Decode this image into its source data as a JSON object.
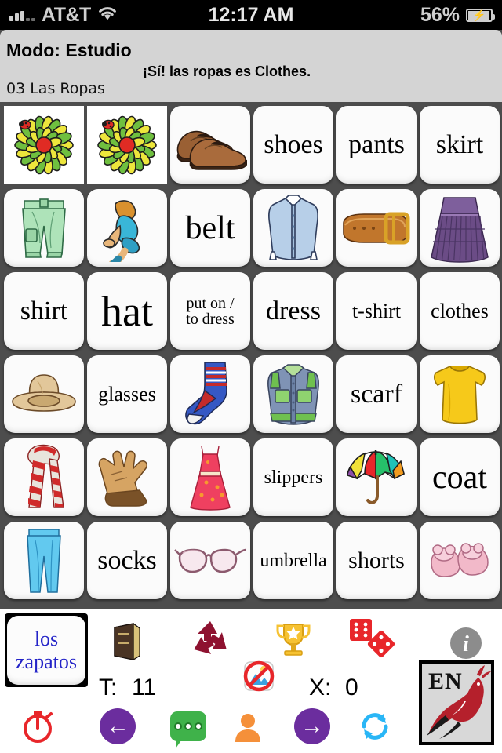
{
  "status_bar": {
    "carrier": "AT&T",
    "time": "12:17 AM",
    "battery_percent": "56%",
    "signal_icon": "signal-bars-icon",
    "wifi_icon": "wifi-icon",
    "battery_icon": "battery-charging-icon"
  },
  "header": {
    "mode": "Modo: Estudio",
    "feedback": "¡Sí! las ropas es Clothes.",
    "lesson": "03 Las Ropas"
  },
  "grid": {
    "columns": 6,
    "rows": 6,
    "cells": [
      {
        "type": "image",
        "icon": "flower-ladybug-icon",
        "label": "",
        "style": "flat"
      },
      {
        "type": "image",
        "icon": "flower-ladybug-icon",
        "label": "",
        "style": "flat"
      },
      {
        "type": "image",
        "icon": "brown-shoes-icon",
        "label": ""
      },
      {
        "type": "text",
        "icon": "",
        "label": "shoes"
      },
      {
        "type": "text",
        "icon": "",
        "label": "pants"
      },
      {
        "type": "text",
        "icon": "",
        "label": "skirt"
      },
      {
        "type": "image",
        "icon": "green-shorts-icon",
        "label": ""
      },
      {
        "type": "image",
        "icon": "boy-dressing-icon",
        "label": ""
      },
      {
        "type": "text",
        "icon": "",
        "label": "belt"
      },
      {
        "type": "image",
        "icon": "blue-shirt-icon",
        "label": ""
      },
      {
        "type": "image",
        "icon": "leather-belt-icon",
        "label": ""
      },
      {
        "type": "image",
        "icon": "purple-skirt-icon",
        "label": ""
      },
      {
        "type": "text",
        "icon": "",
        "label": "shirt"
      },
      {
        "type": "text",
        "icon": "",
        "label": "hat"
      },
      {
        "type": "text",
        "icon": "",
        "label": "put on /\nto dress"
      },
      {
        "type": "text",
        "icon": "",
        "label": "dress"
      },
      {
        "type": "text",
        "icon": "",
        "label": "t-shirt"
      },
      {
        "type": "text",
        "icon": "",
        "label": "clothes"
      },
      {
        "type": "image",
        "icon": "tan-hat-icon",
        "label": ""
      },
      {
        "type": "text",
        "icon": "",
        "label": "glasses"
      },
      {
        "type": "image",
        "icon": "striped-sock-icon",
        "label": ""
      },
      {
        "type": "image",
        "icon": "denim-jacket-icon",
        "label": ""
      },
      {
        "type": "text",
        "icon": "",
        "label": "scarf"
      },
      {
        "type": "image",
        "icon": "yellow-tshirt-icon",
        "label": ""
      },
      {
        "type": "image",
        "icon": "red-striped-scarf-icon",
        "label": ""
      },
      {
        "type": "image",
        "icon": "brown-gloves-icon",
        "label": ""
      },
      {
        "type": "image",
        "icon": "red-dress-icon",
        "label": ""
      },
      {
        "type": "text",
        "icon": "",
        "label": "slippers"
      },
      {
        "type": "image",
        "icon": "rainbow-umbrella-icon",
        "label": ""
      },
      {
        "type": "text",
        "icon": "",
        "label": "coat"
      },
      {
        "type": "image",
        "icon": "blue-pants-icon",
        "label": ""
      },
      {
        "type": "text",
        "icon": "",
        "label": "socks"
      },
      {
        "type": "image",
        "icon": "pink-eyeglasses-icon",
        "label": ""
      },
      {
        "type": "text",
        "icon": "",
        "label": "umbrella"
      },
      {
        "type": "text",
        "icon": "",
        "label": "shorts"
      },
      {
        "type": "image",
        "icon": "pink-slippers-icon",
        "label": ""
      }
    ]
  },
  "toolbar": {
    "word_button": {
      "line1": "los",
      "line2": "zapatos",
      "name": "current-word-button"
    },
    "book_icon": "book-icon",
    "recycle_icon": "recycle-icon",
    "trophy_icon": "trophy-icon",
    "dice_icon": "dice-icon",
    "info_icon": "info-icon",
    "no_image_icon": "no-image-icon",
    "timer_label": "T:",
    "timer_value": "11",
    "x_label": "X:",
    "x_value": "0",
    "language_button": {
      "code": "EN",
      "name": "language-toggle-button"
    },
    "bottom_icons": [
      {
        "name": "stopwatch-icon",
        "label": ""
      },
      {
        "name": "back-arrow-icon",
        "label": "←"
      },
      {
        "name": "chat-bubble-icon",
        "label": ""
      },
      {
        "name": "person-icon",
        "label": ""
      },
      {
        "name": "forward-arrow-icon",
        "label": "→"
      },
      {
        "name": "refresh-icon",
        "label": ""
      }
    ]
  },
  "colors": {
    "background": "#4d4d4d",
    "header_bg": "#d4d4d4",
    "cell_bg": "#fbfbfb",
    "word_text": "#2323c8",
    "purple": "#6b2d9e",
    "green": "#3fb24a",
    "cyan": "#29b6f6",
    "red": "#e8262a",
    "orange": "#f5903a",
    "gold": "#f6c232"
  }
}
